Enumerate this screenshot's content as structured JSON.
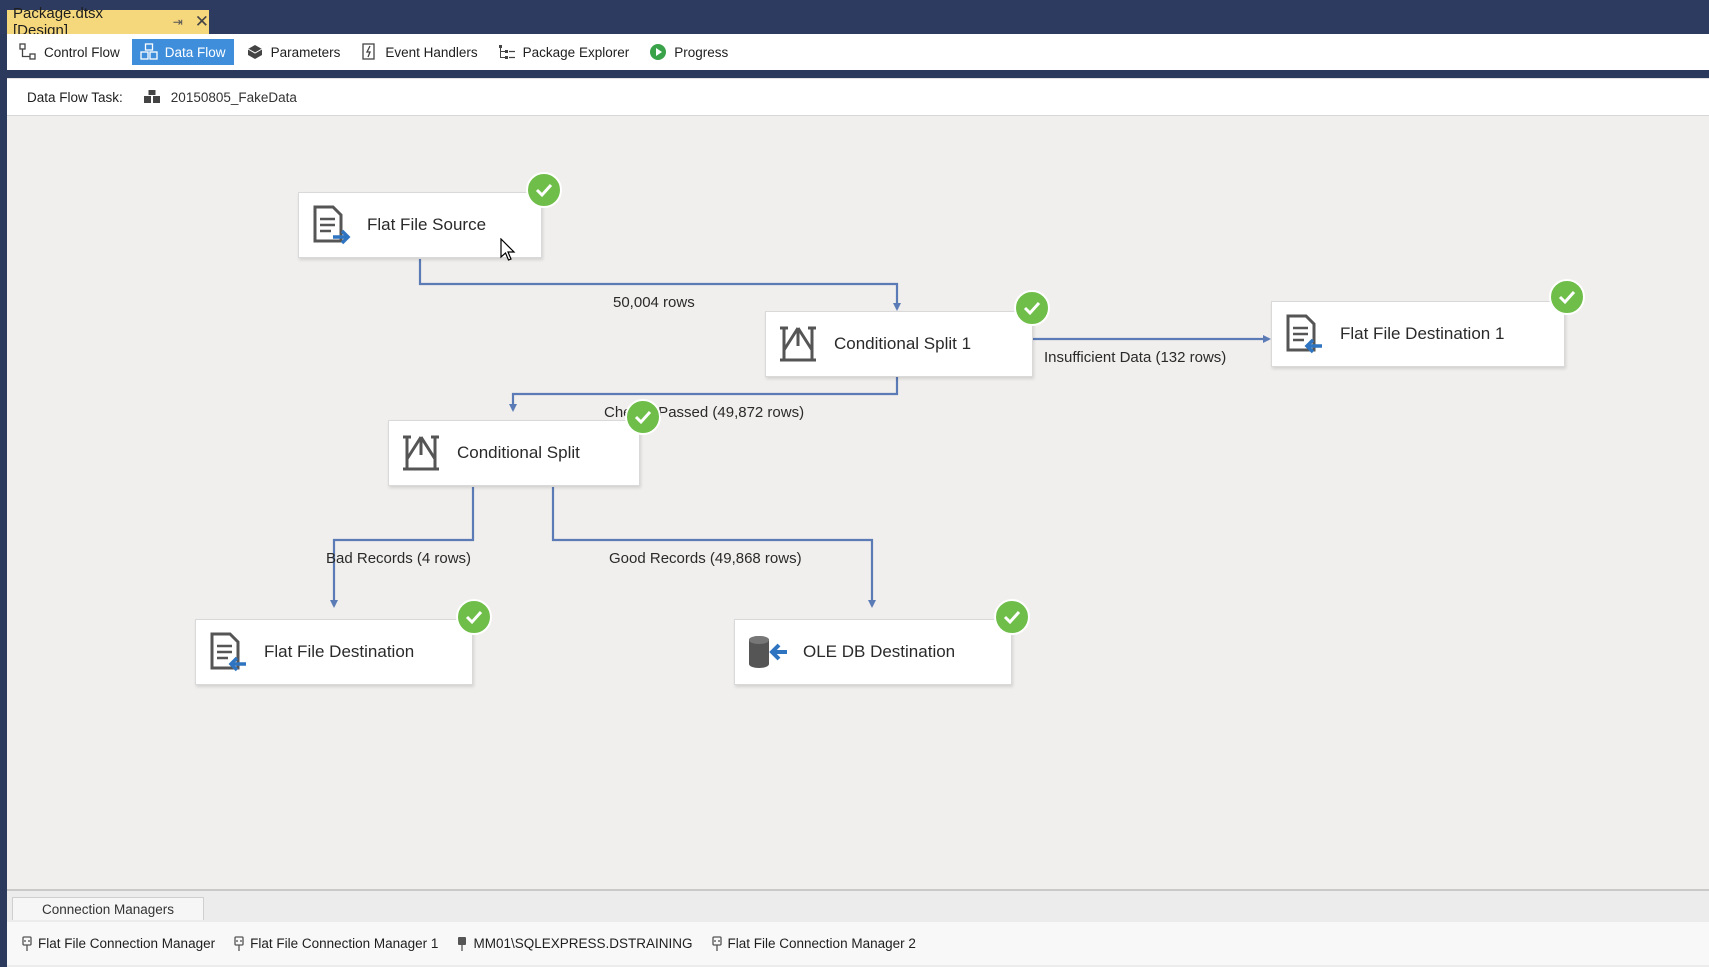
{
  "document_tab": {
    "title": "Package.dtsx [Design]",
    "pin_glyph": "⇥",
    "close_glyph": "✕"
  },
  "toolbar": {
    "items": [
      {
        "label": "Control Flow",
        "icon": "control-flow-icon"
      },
      {
        "label": "Data Flow",
        "icon": "data-flow-icon",
        "active": true
      },
      {
        "label": "Parameters",
        "icon": "parameters-icon"
      },
      {
        "label": "Event Handlers",
        "icon": "event-handlers-icon"
      },
      {
        "label": "Package Explorer",
        "icon": "package-explorer-icon"
      },
      {
        "label": "Progress",
        "icon": "progress-icon"
      }
    ]
  },
  "task_bar": {
    "label": "Data Flow Task:",
    "value": "20150805_FakeData"
  },
  "components": {
    "flat_file_source": {
      "label": "Flat File Source",
      "status": "success"
    },
    "conditional_split_1": {
      "label": "Conditional Split 1",
      "status": "success"
    },
    "flat_file_destination_1": {
      "label": "Flat File Destination 1",
      "status": "success"
    },
    "conditional_split": {
      "label": "Conditional Split",
      "status": "success"
    },
    "flat_file_destination": {
      "label": "Flat File Destination",
      "status": "success"
    },
    "ole_db_destination": {
      "label": "OLE DB Destination",
      "status": "success"
    }
  },
  "paths": {
    "source_to_split1": "50,004 rows",
    "split1_insufficient": "Insufficient Data (132 rows)",
    "split1_checks_passed": "Checks Passed (49,872 rows)",
    "split_bad": "Bad Records (4 rows)",
    "split_good": "Good Records (49,868 rows)"
  },
  "connection_managers": {
    "tab_label": "Connection Managers",
    "items": [
      "Flat File Connection Manager",
      "Flat File Connection Manager 1",
      "MM01\\SQLEXPRESS.DSTRAINING",
      "Flat File Connection Manager 2"
    ]
  },
  "colors": {
    "title_bar": "#2d3b61",
    "doc_tab": "#f5d77c",
    "active_tab": "#3e8edc",
    "canvas": "#f1efed",
    "path_line": "#5b7bb6",
    "success_check": "#6fbe4a",
    "arrow_blue": "#2f74c0"
  }
}
